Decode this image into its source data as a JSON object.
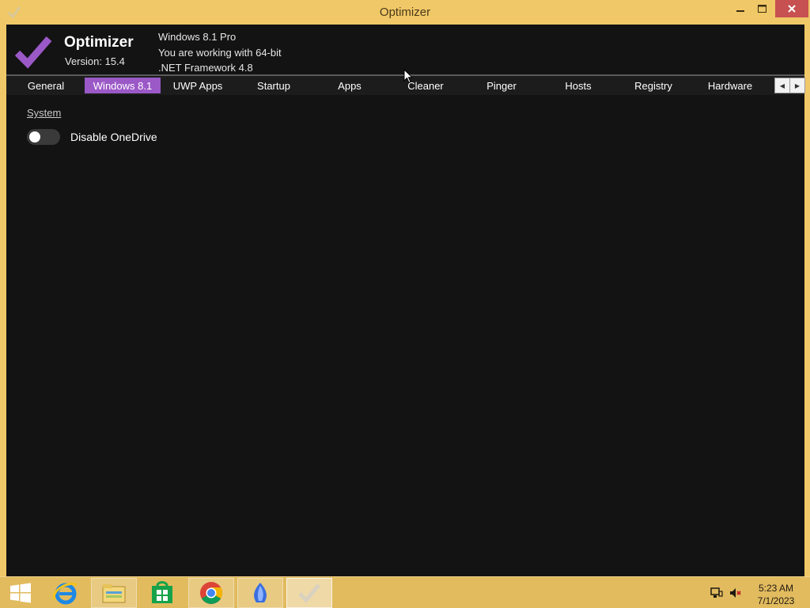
{
  "window": {
    "title": "Optimizer",
    "controls": {
      "minimize_icon": "minimize-icon",
      "maximize_icon": "maximize-icon",
      "close_icon": "close-icon"
    }
  },
  "app": {
    "name": "Optimizer",
    "version": "Version: 15.4",
    "system_info": [
      "Windows 8.1 Pro",
      "You are working with 64-bit",
      ".NET Framework 4.8"
    ],
    "accent_color": "#9b59c7"
  },
  "tabs": [
    {
      "label": "General",
      "active": false
    },
    {
      "label": "Windows 8.1",
      "active": true
    },
    {
      "label": "UWP Apps",
      "active": false
    },
    {
      "label": "Startup",
      "active": false
    },
    {
      "label": "Apps",
      "active": false
    },
    {
      "label": "Cleaner",
      "active": false
    },
    {
      "label": "Pinger",
      "active": false
    },
    {
      "label": "Hosts",
      "active": false
    },
    {
      "label": "Registry",
      "active": false
    },
    {
      "label": "Hardware",
      "active": false
    }
  ],
  "tab_page": {
    "section": "System",
    "toggles": [
      {
        "label": "Disable OneDrive",
        "on": false
      }
    ]
  },
  "taskbar": {
    "apps": [
      {
        "name": "start-button"
      },
      {
        "name": "internet-explorer-icon"
      },
      {
        "name": "file-explorer-icon"
      },
      {
        "name": "store-icon"
      },
      {
        "name": "chrome-icon"
      },
      {
        "name": "app-icon"
      },
      {
        "name": "optimizer-icon"
      }
    ],
    "tray": [
      "network-icon",
      "volume-muted-icon"
    ],
    "clock": {
      "time": "5:23 AM",
      "date": "7/1/2023"
    }
  }
}
